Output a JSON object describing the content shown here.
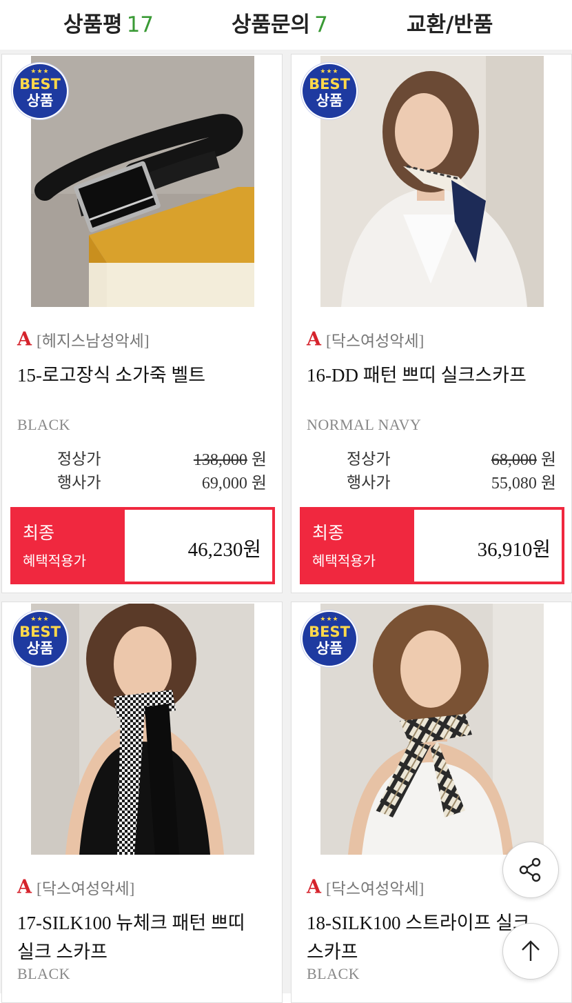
{
  "tabs": [
    {
      "label": "상품평",
      "count": "17"
    },
    {
      "label": "상품문의",
      "count": "7"
    },
    {
      "label": "교환/반품",
      "count": ""
    }
  ],
  "badge": {
    "line1": "BEST",
    "line2": "상품",
    "stars": "★★★"
  },
  "labels": {
    "regular": "정상가",
    "event": "행사가",
    "final_line1": "최종",
    "final_line2": "혜택적용가",
    "brand_logo": "A"
  },
  "products": [
    {
      "brand": "[헤지스남성악세]",
      "name": "15-로고장식 소가죽 벨트",
      "color": "BLACK",
      "regular_price": "138,000",
      "event_price": "69,000",
      "final_price": "46,230원",
      "currency": "원",
      "best": true
    },
    {
      "brand": "[닥스여성악세]",
      "name": "16-DD 패턴 쁘띠 실크스카프",
      "color": "NORMAL NAVY",
      "regular_price": "68,000",
      "event_price": "55,080",
      "final_price": "36,910원",
      "currency": "원",
      "best": true
    },
    {
      "brand": "[닥스여성악세]",
      "name": "17-SILK100 뉴체크 패턴 쁘띠 실크 스카프",
      "color": "BLACK",
      "best": true
    },
    {
      "brand": "[닥스여성악세]",
      "name": "18-SILK100 스트라이프 실크 스카프",
      "color": "BLACK",
      "best": true
    }
  ],
  "floating": {
    "share": "share-icon",
    "top": "arrow-up-icon"
  },
  "colors": {
    "accent_green": "#3a9a35",
    "sale_red": "#f0283f",
    "badge_blue": "#1e3aa0",
    "brand_red": "#d5232c"
  }
}
